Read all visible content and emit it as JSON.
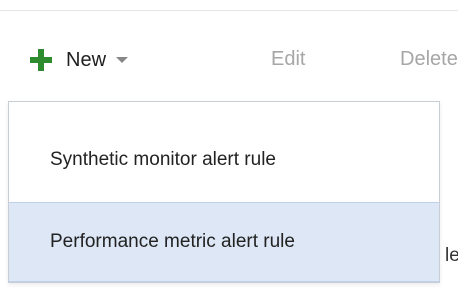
{
  "toolbar": {
    "new_label": "New",
    "edit_label": "Edit",
    "delete_label": "Delete"
  },
  "new_menu": {
    "items": [
      {
        "label": "Synthetic monitor alert rule",
        "highlighted": false
      },
      {
        "label": "Performance metric alert rule",
        "highlighted": true
      }
    ]
  },
  "background_text": {
    "partial": "le"
  },
  "icons": {
    "new": "plus-icon",
    "dropdown": "chevron-down-icon"
  },
  "colors": {
    "plus_icon": "#2e8b2e",
    "disabled_text": "#a6a6a6",
    "highlight": "#dde7f5"
  }
}
